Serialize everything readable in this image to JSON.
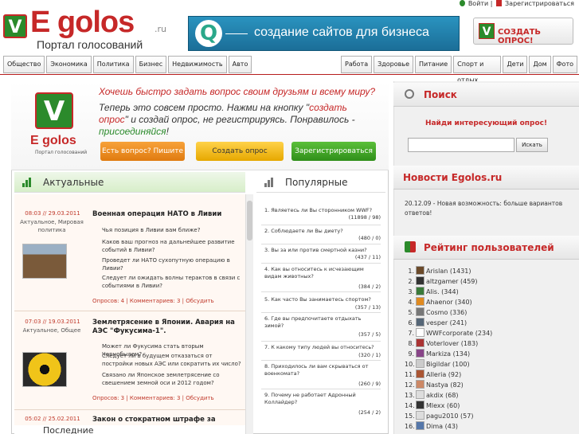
{
  "header": {
    "logo_text": "E golos",
    "logo_tld": ".ru",
    "logo_tagline": "Портал голосований",
    "ad_text": "создание сайтов для бизнеса",
    "login": "Войти",
    "register": "Зарегистрироваться",
    "create_button": "СОЗДАТЬ ОПРОС!"
  },
  "nav": {
    "left": [
      "Общество",
      "Экономика",
      "Политика",
      "Бизнес",
      "Недвижимость",
      "Авто"
    ],
    "right": [
      "Работа",
      "Здоровье",
      "Питание",
      "Спорт и отдых",
      "Дети",
      "Дом",
      "Фото"
    ]
  },
  "promo": {
    "headline": "Хочешь быстро задать вопрос своим друзьям и всему миру?",
    "text_a": "Теперь это совсем просто. Нажми на кнопку \"",
    "text_link1": "создать опрос",
    "text_b": "\" и создай опрос, не регистрируясь. Понравилось - ",
    "text_link2": "присоединяйся",
    "text_c": "!",
    "logo_small": "E golos",
    "logo_small_tag": "Портал голосований",
    "btn_ask": "Есть вопрос? Пишите",
    "btn_create": "Создать опрос",
    "btn_register": "Зарегистрироваться"
  },
  "actual": {
    "title": "Актуальные",
    "items": [
      {
        "date": "08:03 // 29.03.2011",
        "category": "Актуальное, Мировая политика",
        "title": "Военная операция НАТО в Ливии",
        "questions": [
          "Чья позиция в Ливии вам ближе?",
          "Каков ваш прогноз на дальнейшее развитие событий в Ливии?",
          "Проведет ли НАТО сухопутную операцию в Ливии?",
          "Следует ли ожидать волны терактов в связи с событиями в Ливии?"
        ],
        "meta": "Опросов: 4 | Комментариев: 3 | Обсудить"
      },
      {
        "date": "07:03 // 19.03.2011",
        "category": "Актуальное, Общее",
        "title": "Землетрясение в Японии. Авария на АЭС \"Фукусима-1\".",
        "questions": [
          "Может ли Фукусима стать вторым Чернобылем?",
          "Следует ли в будущем отказаться от постройки новых АЭС или сократить их число?",
          "Связано ли Японское землетрясение со свешением земной оси и 2012 годом?"
        ],
        "meta": "Опросов: 3 | Комментариев: 3 | Обсудить"
      },
      {
        "date": "05:02 // 25.02.2011",
        "title": "Закон о стократном штрафе за взятку"
      }
    ]
  },
  "popular": {
    "title": "Популярные",
    "items": [
      {
        "q": "1. Являетесь ли Вы сторонником WWF?",
        "stat": "(11898 / 98)"
      },
      {
        "q": "2. Соблюдаете ли Вы диету?",
        "stat": "(480 / 0)"
      },
      {
        "q": "3. Вы за или против смертной казни?",
        "stat": "(437 / 11)"
      },
      {
        "q": "4. Как вы относитесь к исчезающим видам животных?",
        "stat": "(384 / 2)"
      },
      {
        "q": "5. Как часто Вы занимаетесь спортом?",
        "stat": "(357 / 13)"
      },
      {
        "q": "6. Где вы предпочитаете отдыхать зимой?",
        "stat": "(357 / 5)"
      },
      {
        "q": "7. К какому типу людей вы относитесь?",
        "stat": "(320 / 1)"
      },
      {
        "q": "8. Приходилось ли вам скрываться от военкомата?",
        "stat": "(260 / 9)"
      },
      {
        "q": "9. Почему не работает Адронный Коллайдер?",
        "stat": "(254 / 2)"
      }
    ]
  },
  "search": {
    "title": "Поиск",
    "subtitle": "Найди интересующий опрос!",
    "button": "Искать"
  },
  "news": {
    "title": "Новости Egolos.ru",
    "text": "20.12.09 - Новая возможность: больше вариантов ответов!"
  },
  "rating": {
    "title": "Рейтинг пользователей",
    "users": [
      {
        "n": "1.",
        "name": "Arislan (1431)",
        "color": "#6b4a2a"
      },
      {
        "n": "2.",
        "name": "altzgamer (459)",
        "color": "#333333"
      },
      {
        "n": "3.",
        "name": "Alis. (344)",
        "color": "#3a7a3a"
      },
      {
        "n": "4.",
        "name": "Ahaenor (340)",
        "color": "#e08a20"
      },
      {
        "n": "5.",
        "name": "Cosmo (336)",
        "color": "#777777"
      },
      {
        "n": "6.",
        "name": "vesper (241)",
        "color": "#556677"
      },
      {
        "n": "7.",
        "name": "WWFcorporate (234)",
        "color": "#ffffff"
      },
      {
        "n": "8.",
        "name": "Voterlover (183)",
        "color": "#aa3333"
      },
      {
        "n": "9.",
        "name": "Markiza (134)",
        "color": "#884488"
      },
      {
        "n": "10.",
        "name": "Bigildar (100)",
        "color": "#cccccc"
      },
      {
        "n": "11.",
        "name": "Alleria (92)",
        "color": "#aa5533"
      },
      {
        "n": "12.",
        "name": "Nastya (82)",
        "color": "#cc8866"
      },
      {
        "n": "13.",
        "name": "akdix (68)",
        "color": "#dddddd"
      },
      {
        "n": "14.",
        "name": "Mlexx (60)",
        "color": "#333333"
      },
      {
        "n": "15.",
        "name": "pagu2010 (57)",
        "color": "#dddddd"
      },
      {
        "n": "16.",
        "name": "Dima (43)",
        "color": "#5577aa"
      }
    ]
  },
  "bottom": {
    "title": "Последние"
  }
}
